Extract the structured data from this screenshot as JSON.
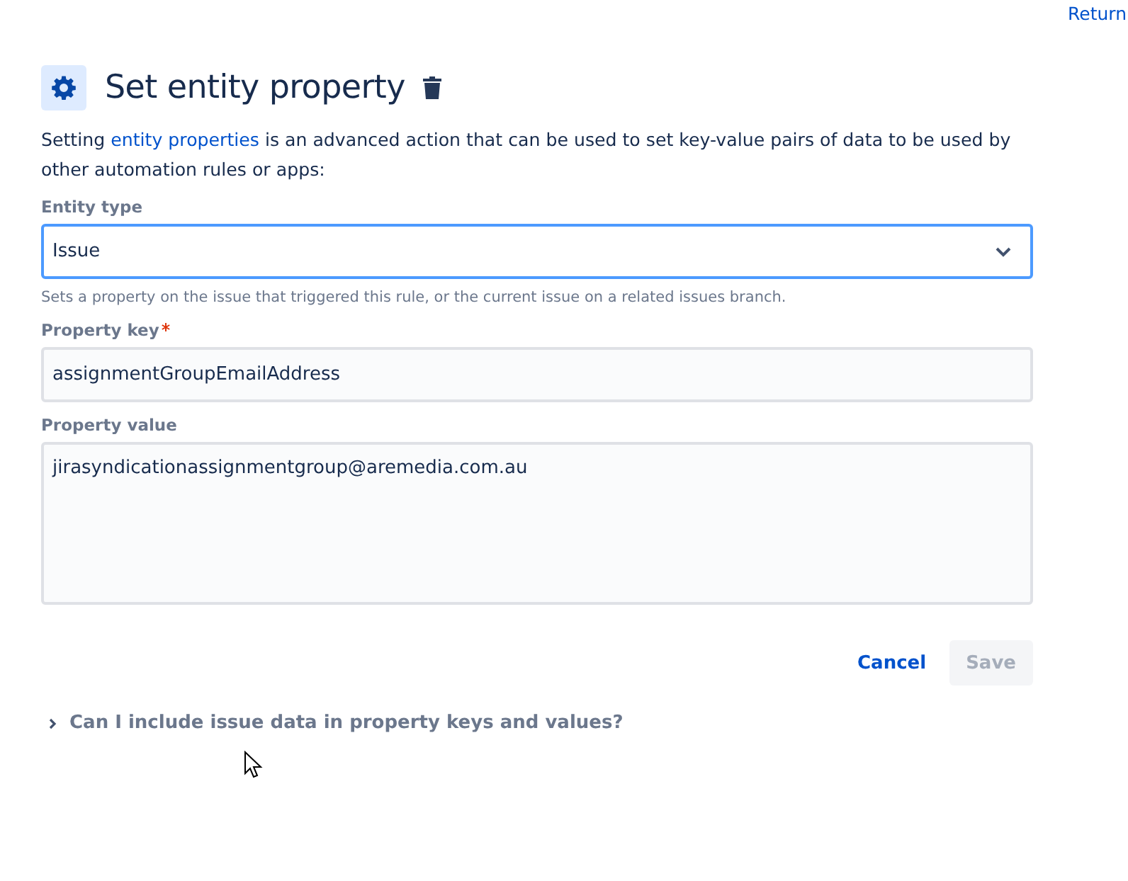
{
  "top_link": "Return",
  "title": "Set entity property",
  "description": {
    "before": "Setting ",
    "link": "entity properties",
    "after": " is an advanced action that can be used to set key-value pairs of data to be used by other automation rules or apps:"
  },
  "fields": [
    {
      "kind": "select",
      "label": "Entity type",
      "required": false,
      "value": "Issue",
      "focused": true,
      "helper": "Sets a property on the issue that triggered this rule, or the current issue on a related issues branch."
    },
    {
      "kind": "input",
      "label": "Property key",
      "required": true,
      "value": "assignmentGroupEmailAddress",
      "focused": false
    },
    {
      "kind": "textarea",
      "label": "Property value",
      "required": false,
      "value": "jirasyndicationassignmentgroup@aremedia.com.au",
      "focused": false
    }
  ],
  "buttons": [
    {
      "kind": "link",
      "label": "Cancel",
      "disabled": false
    },
    {
      "kind": "primary",
      "label": "Save",
      "disabled": true
    }
  ],
  "expander": {
    "label": "Can I include issue data in property keys and values?",
    "expanded": false
  }
}
